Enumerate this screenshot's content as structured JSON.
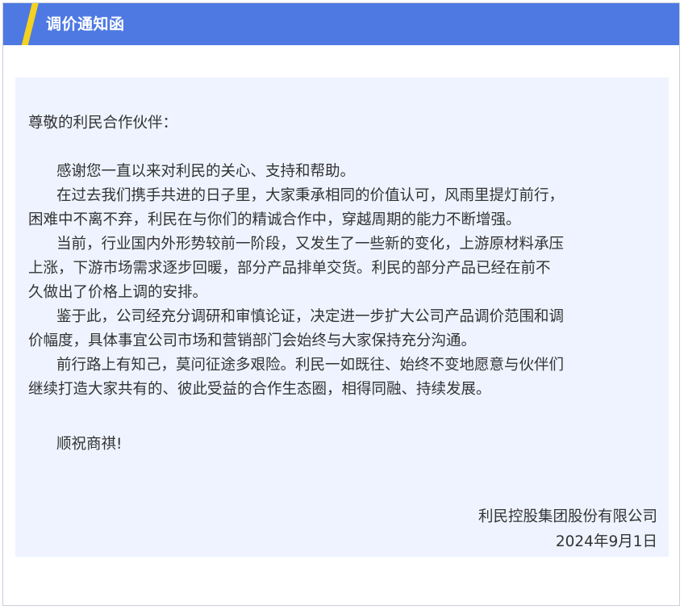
{
  "header": {
    "title": "调价通知函",
    "accent_color": "#f4d21f",
    "bar_color": "#4e79e3"
  },
  "letter": {
    "salutation": "尊敬的利民合作伙伴：",
    "lines": [
      "感谢您一直以来对利民的关心、支持和帮助。",
      "在过去我们携手共进的日子里，大家秉承相同的价值认可，风雨里提灯前行，",
      "困难中不离不弃，利民在与你们的精诚合作中，穿越周期的能力不断增强。",
      "当前，行业国内外形势较前一阶段，又发生了一些新的变化，上游原材料承压",
      "上涨，下游市场需求逐步回暖，部分产品排单交货。利民的部分产品已经在前不",
      "久做出了价格上调的安排。",
      "鉴于此，公司经充分调研和审慎论证，决定进一步扩大公司产品调价范围和调",
      "价幅度，具体事宜公司市场和营销部门会始终与大家保持充分沟通。",
      "前行路上有知己，莫问征途多艰险。利民一如既往、始终不变地愿意与伙伴们",
      "继续打造大家共有的、彼此受益的合作生态圈，相得同融、持续发展。"
    ],
    "closing": "顺祝商祺!",
    "signature_company": "利民控股集团股份有限公司",
    "signature_date": "2024年9月1日"
  }
}
